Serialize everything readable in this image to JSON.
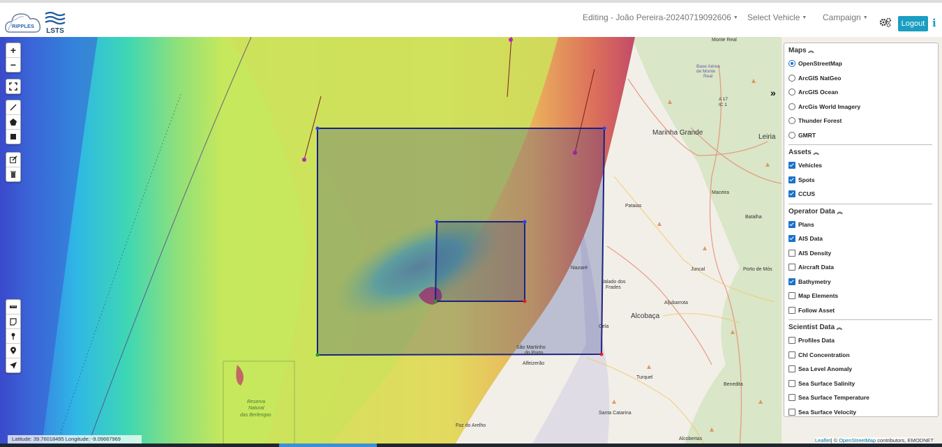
{
  "header": {
    "logo_text": "RIPPLES",
    "brand": "LSTS",
    "editing_label": "Editing - João Pereira-20240719092606",
    "select_vehicle_label": "Select Vehicle",
    "campaign_label": "Campaign",
    "settings_icon": "gears-icon",
    "logout_label": "Logout",
    "info_icon": "info-icon",
    "accent_color": "#1a9ec2"
  },
  "map_controls": {
    "zoom_in": "+",
    "zoom_out": "−",
    "fullscreen_icon": "fullscreen-icon",
    "draw_tools": [
      "draw-line-icon",
      "draw-polygon-icon",
      "draw-rectangle-icon"
    ],
    "edit_tools": [
      "edit-icon",
      "delete-icon"
    ],
    "extra_tools": [
      "ruler-icon",
      "note-icon",
      "pin-icon",
      "marker-icon",
      "navigate-icon"
    ]
  },
  "layers_panel": {
    "toggle_icon": "double-chevron-right-icon",
    "sections": [
      {
        "title": "Maps",
        "type": "radio",
        "items": [
          {
            "label": "OpenStreetMap",
            "checked": true
          },
          {
            "label": "ArcGIS NatGeo",
            "checked": false
          },
          {
            "label": "ArcGIS Ocean",
            "checked": false
          },
          {
            "label": "ArcGis World Imagery",
            "checked": false
          },
          {
            "label": "Thunder Forest",
            "checked": false
          },
          {
            "label": "GMRT",
            "checked": false
          }
        ]
      },
      {
        "title": "Assets",
        "type": "checkbox",
        "items": [
          {
            "label": "Vehicles",
            "checked": true
          },
          {
            "label": "Spots",
            "checked": true
          },
          {
            "label": "CCUS",
            "checked": true
          }
        ]
      },
      {
        "title": "Operator Data",
        "type": "checkbox",
        "items": [
          {
            "label": "Plans",
            "checked": true
          },
          {
            "label": "AIS Data",
            "checked": true
          },
          {
            "label": "AIS Density",
            "checked": false
          },
          {
            "label": "Aircraft Data",
            "checked": false
          },
          {
            "label": "Bathymetry",
            "checked": true
          },
          {
            "label": "Map Elements",
            "checked": false
          },
          {
            "label": "Follow Asset",
            "checked": false
          }
        ]
      },
      {
        "title": "Scientist Data",
        "type": "checkbox",
        "items": [
          {
            "label": "Profiles Data",
            "checked": false
          },
          {
            "label": "Chl Concentration",
            "checked": false
          },
          {
            "label": "Sea Level Anomaly",
            "checked": false
          },
          {
            "label": "Sea Surface Salinity",
            "checked": false
          },
          {
            "label": "Sea Surface Temperature",
            "checked": false
          },
          {
            "label": "Sea Surface Velocity",
            "checked": false
          }
        ]
      }
    ]
  },
  "map_labels": {
    "marinha_grande": "Marinha Grande",
    "leiria": "Leiria",
    "monte_real": "Monte Real",
    "base_aerea": "Base Aérea",
    "de_monte": "de Monte",
    "real": "Real",
    "a17": "A 17",
    "ic1": "IC 1",
    "maceira": "Maceira",
    "pataias": "Pataias",
    "batalha": "Batalha",
    "nazare": "Nazaré",
    "valado": "Valado dos",
    "frades": "Frades",
    "juncal": "Juncal",
    "porto_mos": "Porto de Mós",
    "alcobaca": "Alcobaça",
    "aljubarrota": "Aljubarrota",
    "cela": "Cela",
    "sao_martinho": "São Martinho",
    "do_porto": "do Porto",
    "alfeizerao": "Alfeizerão",
    "turquel": "Turquel",
    "benedita": "Benedita",
    "santa_catarina": "Santa Catarina",
    "foz_arelho": "Foz do Arelho",
    "alcobertas": "Alcobertas",
    "reserva1": "Reserva",
    "reserva2": "Natural",
    "reserva3": "das Berlengas"
  },
  "coordinates": "Latitude: 39.76018495  Longitude: -9.09667969",
  "attribution": {
    "leaflet": "Leaflet",
    "osm_prefix": "| © ",
    "osm": "OpenStreetMap",
    "suffix": " contributors, EMODNET"
  }
}
